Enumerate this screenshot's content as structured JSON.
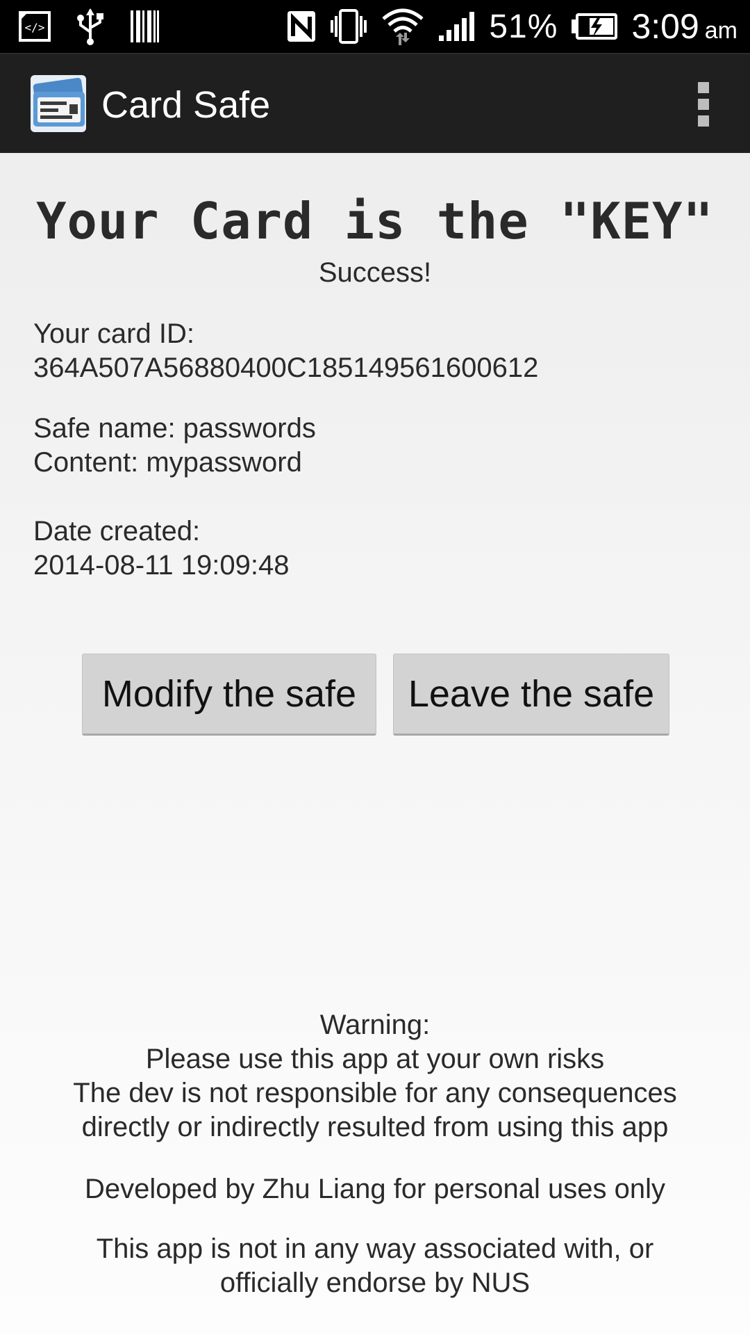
{
  "status_bar": {
    "battery_percent": "51%",
    "time": "3:09",
    "ampm": "am",
    "icons": [
      "dev-tools-icon",
      "usb-icon",
      "barcode-icon",
      "nfc-icon",
      "vibrate-icon",
      "wifi-icon",
      "signal-icon",
      "battery-charging-icon"
    ]
  },
  "action_bar": {
    "app_title": "Card Safe",
    "app_icon": "card-safe-icon",
    "overflow_icon": "overflow-menu-icon"
  },
  "main": {
    "heading": "Your Card is the \"KEY\"",
    "status": "Success!",
    "card_id_label": "Your card ID:",
    "card_id_value": "364A507A56880400C185149561600612",
    "safe_name": "Safe name: passwords",
    "content": "Content: mypassword",
    "date_label": "Date created:",
    "date_value": "2014-08-11 19:09:48"
  },
  "buttons": {
    "modify_label": "Modify the safe",
    "leave_label": "Leave the safe"
  },
  "footer": {
    "warning_title": "Warning:",
    "warning_line1": "Please use this app at your own risks",
    "warning_line2": "The dev is not responsible for any consequences",
    "warning_line3": "directly or indirectly resulted from using this app",
    "developer": "Developed by Zhu Liang for personal uses only",
    "disclaimer_line1": "This app is not in any way associated with, or",
    "disclaimer_line2": "officially endorse by NUS"
  },
  "colors": {
    "status_bar_bg": "#000000",
    "action_bar_bg": "#1f1f1f",
    "button_bg": "#d3d3d3",
    "text": "#2a2a2a"
  }
}
